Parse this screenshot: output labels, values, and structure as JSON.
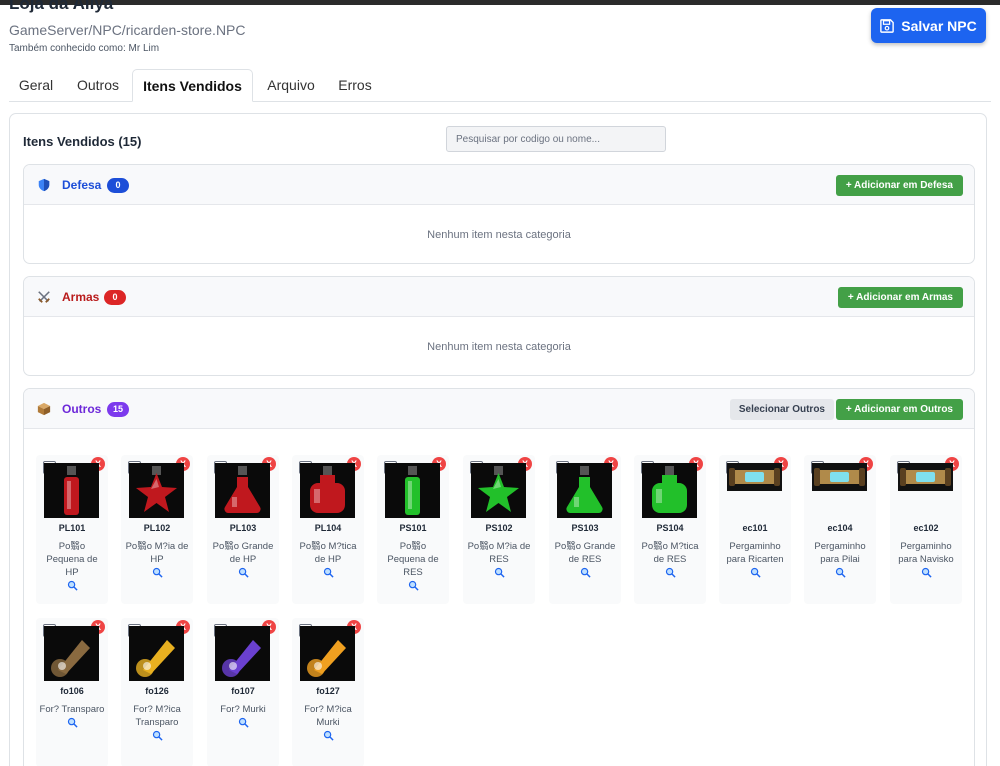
{
  "header": {
    "title": "Loja da Aliya",
    "path": "GameServer/NPC/ricarden-store.NPC",
    "aka": "Também conhecido como: Mr Lim",
    "save_label": "Salvar NPC"
  },
  "tabs": [
    {
      "label": "Geral"
    },
    {
      "label": "Outros"
    },
    {
      "label": "Itens Vendidos",
      "active": true
    },
    {
      "label": "Arquivo"
    },
    {
      "label": "Erros"
    }
  ],
  "panel": {
    "title": "Itens Vendidos (15)",
    "search_placeholder": "Pesquisar por codigo ou nome..."
  },
  "colors": {
    "primary": "#1d64f0",
    "success": "#43a047",
    "defesa": "#1d4ed8",
    "armas": "#b91c1c",
    "outros": "#6d28d9",
    "danger": "#ef4444"
  },
  "categories": {
    "defesa": {
      "name": "Defesa",
      "count": "0",
      "add_label": "+ Adicionar em Defesa",
      "empty_text": "Nenhum item nesta categoria",
      "icon": "shield-icon"
    },
    "armas": {
      "name": "Armas",
      "count": "0",
      "add_label": "+ Adicionar em Armas",
      "empty_text": "Nenhum item nesta categoria",
      "icon": "crossed-swords-icon"
    },
    "outros": {
      "name": "Outros",
      "count": "15",
      "select_label": "Selecionar Outros",
      "add_label": "+ Adicionar em Outros",
      "icon": "package-icon",
      "items": [
        {
          "code": "PL101",
          "name": "Po翳o Pequena de HP",
          "icon": "red-potion-tube-icon",
          "color": "#c0181e"
        },
        {
          "code": "PL102",
          "name": "Po翳o M?ia de HP",
          "icon": "red-potion-star-icon",
          "color": "#c0181e"
        },
        {
          "code": "PL103",
          "name": "Po翳o Grande de HP",
          "icon": "red-potion-flask-icon",
          "color": "#c0181e"
        },
        {
          "code": "PL104",
          "name": "Po翳o M?tica de HP",
          "icon": "red-potion-jar-icon",
          "color": "#c0181e"
        },
        {
          "code": "PS101",
          "name": "Po翳o Pequena de RES",
          "icon": "green-potion-tube-icon",
          "color": "#22c02a"
        },
        {
          "code": "PS102",
          "name": "Po翳o M?ia de RES",
          "icon": "green-potion-star-icon",
          "color": "#22c02a"
        },
        {
          "code": "PS103",
          "name": "Po翳o Grande de RES",
          "icon": "green-potion-flask-icon",
          "color": "#22c02a"
        },
        {
          "code": "PS104",
          "name": "Po翳o M?tica de RES",
          "icon": "green-potion-jar-icon",
          "color": "#22c02a"
        },
        {
          "code": "ec101",
          "name": "Pergaminho para Ricarten",
          "icon": "scroll-icon",
          "color": "#b08a4a"
        },
        {
          "code": "ec104",
          "name": "Pergaminho para Pilai",
          "icon": "scroll-icon",
          "color": "#b08a4a"
        },
        {
          "code": "ec102",
          "name": "Pergaminho para Navisko",
          "icon": "scroll-icon",
          "color": "#b08a4a"
        },
        {
          "code": "fo106",
          "name": "For? Transparo",
          "icon": "force-orb-brown-icon",
          "color": "#8a6a40"
        },
        {
          "code": "fo126",
          "name": "For? M?ica Transparo",
          "icon": "force-orb-gold-icon",
          "color": "#e8b020"
        },
        {
          "code": "fo107",
          "name": "For? Murki",
          "icon": "force-orb-purple-icon",
          "color": "#6a40d0"
        },
        {
          "code": "fo127",
          "name": "For? M?ica Murki",
          "icon": "force-orb-fire-icon",
          "color": "#f0a020"
        }
      ]
    }
  }
}
